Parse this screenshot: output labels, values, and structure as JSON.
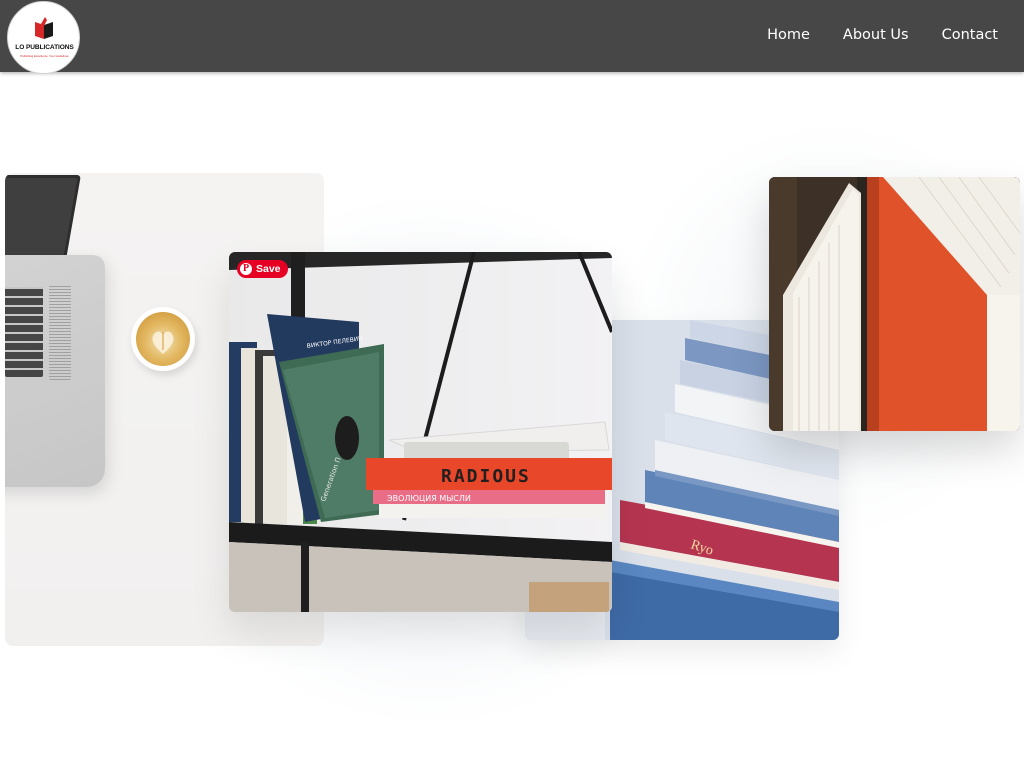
{
  "brand": {
    "name": "LO PUBLICATIONS",
    "tagline": "Publishing Excellence, Your Guidelines"
  },
  "nav": {
    "items": [
      "Home",
      "About Us",
      "Contact"
    ]
  },
  "pin_button": {
    "label": "Save",
    "icon": "pinterest-icon"
  },
  "books": {
    "orange_book_title": "RADIOUS",
    "pink_book_title": "ЭВОЛЮЦИЯ МЫСЛИ",
    "green_book_author": "ВИКТОР ПЕЛЕВИН",
    "green_book_title": "Generation П"
  },
  "colors": {
    "header_bg": "#474747",
    "nav_text": "#ffffff",
    "pin_red": "#e60023",
    "logo_red": "#cc2222"
  }
}
